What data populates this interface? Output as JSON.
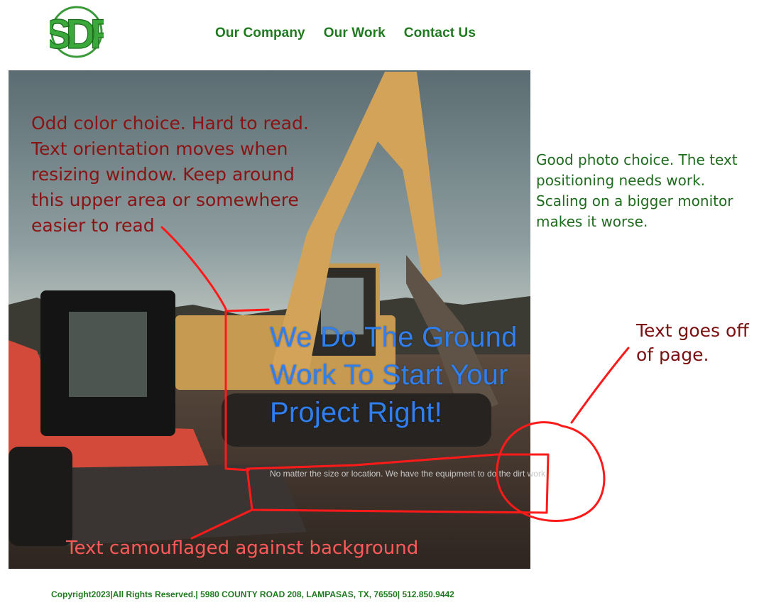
{
  "logo": {
    "text": "SDF",
    "color": "#2e9e2e"
  },
  "nav": {
    "items": [
      {
        "label": "Our Company"
      },
      {
        "label": "Our Work"
      },
      {
        "label": "Contact Us"
      }
    ],
    "color": "#1f7a1f"
  },
  "hero": {
    "headline": "We Do The Ground Work To Start Your Project Right!",
    "subtext": "No matter the size or location. We have the equipment to do the dirt work",
    "headline_color": "#2f7ff0"
  },
  "annotations": {
    "color_note": "Odd color choice. Hard to read. Text orientation moves when resizing window.  Keep around this upper area or somewhere easier to read",
    "photo_note": "Good photo choice. The text positioning needs work. Scaling on a bigger monitor makes it worse.",
    "offpage_note": "Text goes off of page.",
    "camo_note": "Text camouflaged against background",
    "markup_color": "#ff0000"
  },
  "footer": {
    "text": "Copyright2023|All Rights Reserved.| 5980 COUNTY ROAD 208, LAMPASAS, TX, 76550| 512.850.9442"
  }
}
